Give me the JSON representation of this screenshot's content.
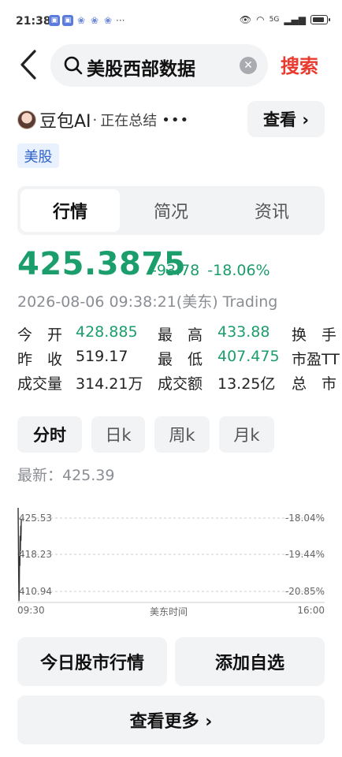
{
  "status_bar": {
    "time": "21:38",
    "network": "5G",
    "notification_icons": [
      "app-notification-icon",
      "app-notification-icon",
      "paw-icon",
      "paw-icon",
      "paw-icon"
    ],
    "more": "···"
  },
  "search": {
    "query": "美股西部数据",
    "button_label": "搜索"
  },
  "ai_summary": {
    "name": "豆包AI",
    "separator": "·",
    "status": "正在总结",
    "dots": "•••",
    "view_label": "查看 ›"
  },
  "market_tag": "美股",
  "tabs": [
    {
      "label": "行情",
      "active": true
    },
    {
      "label": "简况",
      "active": false
    },
    {
      "label": "资讯",
      "active": false
    }
  ],
  "quote": {
    "price": "425.3875",
    "change": "-93.78",
    "change_pct": "-18.06%",
    "timestamp": "2026-08-06 09:38:21(美东) Trading",
    "color_down": "#1c9d6c"
  },
  "stats": [
    [
      {
        "label": "今　开",
        "value": "428.885",
        "green": true
      },
      {
        "label": "最　高",
        "value": "433.88",
        "green": true
      },
      {
        "label": "换　手",
        "value": ""
      }
    ],
    [
      {
        "label": "昨　收",
        "value": "519.17",
        "green": false
      },
      {
        "label": "最　低",
        "value": "407.475",
        "green": true
      },
      {
        "label": "市盈TT",
        "value": ""
      }
    ],
    [
      {
        "label": "成交量",
        "value": "314.21万",
        "green": false
      },
      {
        "label": "成交额",
        "value": "13.25亿",
        "green": false
      },
      {
        "label": "总　市",
        "value": ""
      }
    ]
  ],
  "periods": [
    {
      "label": "分时",
      "active": true
    },
    {
      "label": "日k",
      "active": false
    },
    {
      "label": "周k",
      "active": false
    },
    {
      "label": "月k",
      "active": false
    }
  ],
  "latest": "最新：425.39",
  "chart_data": {
    "type": "line",
    "y_left_ticks": [
      "425.53",
      "418.23",
      "410.94"
    ],
    "y_right_ticks": [
      "-18.04%",
      "-19.44%",
      "-20.85%"
    ],
    "x_ticks": [
      "09:30",
      "美东时间",
      "16:00"
    ],
    "ylim": [
      410.94,
      425.53
    ],
    "series": [
      {
        "values": [
          428.885,
          420.0,
          414.0,
          409.0,
          412.0,
          418.0,
          416.0,
          422.0,
          419.0,
          424.0,
          421.0,
          425.39
        ]
      }
    ],
    "line_color": "#333333",
    "grid": true
  },
  "buttons": {
    "today_market": "今日股市行情",
    "add_watchlist": "添加自选",
    "more": "查看更多 ›"
  }
}
